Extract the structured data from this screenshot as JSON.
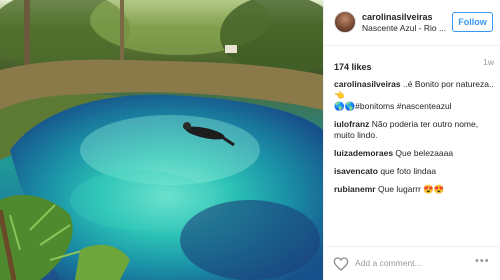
{
  "post": {
    "username": "carolinasilveiras",
    "location": "Nascente Azul - Rio ...",
    "follow_label": "Follow",
    "likes": "174 likes",
    "age": "1w",
    "caption_username": "carolinasilveiras",
    "caption_text": " ..é Bonito por natureza..👈",
    "caption_tags": "🌎🌎#bonitoms #nascenteazul",
    "comments": [
      {
        "user": "iulofranz",
        "text": " Não poderia ter outro nome, muito lindo."
      },
      {
        "user": "luizademoraes",
        "text": " Que belezaaaa"
      },
      {
        "user": "isavencato",
        "text": " que foto lindaa"
      },
      {
        "user": "rubianemr",
        "text": " Que lugarrr 😍😍"
      }
    ],
    "add_comment_placeholder": "Add a comment...",
    "more_label": "•••"
  },
  "icons": {
    "heart": "heart-outline-icon",
    "more": "more-options-icon"
  },
  "colors": {
    "accent": "#3897f0",
    "muted": "#999999",
    "text": "#262626"
  }
}
